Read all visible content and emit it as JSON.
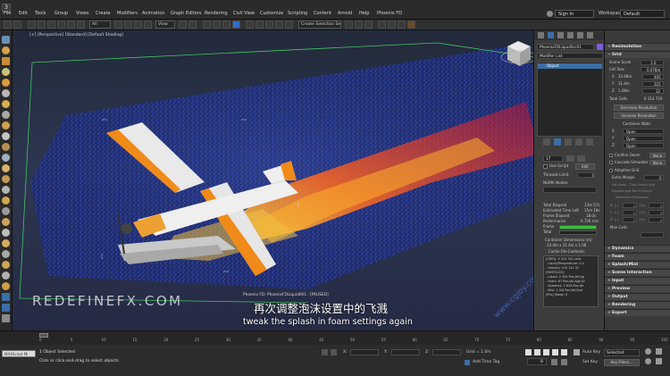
{
  "menubar": {
    "items": [
      "File",
      "Edit",
      "Tools",
      "Group",
      "Views",
      "Create",
      "Modifiers",
      "Animation",
      "Graph Editors",
      "Rendering",
      "Civil View",
      "Customize",
      "Scripting",
      "Content",
      "Arnold",
      "Help",
      "Phoenix FD"
    ],
    "signin": "Sign In",
    "workspaces_label": "Workspaces:",
    "workspaces_value": "Default"
  },
  "toolbar": {
    "selection_filter": "All",
    "view_dropdown": "View",
    "create_selection_set": "Create Selection Se"
  },
  "viewport": {
    "label": "[+] [Perspective] [Standard] [Default Shading]",
    "sim_label": "Phoenix FD: PhoenixFDLiquid001 : [PAUSED]",
    "watermark": "REDEFINEFX.COM",
    "subtitle_cn": "再次调整泡沫设置中的飞溅",
    "subtitle_en": "tweak the splash in foam settings again",
    "side_watermark": "www.cgjoy.com"
  },
  "command_panel": {
    "object_name": "PhoenixFDLiquidSrc01",
    "modifier_list": "Modifier List",
    "stack_item": "Object",
    "start_frame": "17",
    "use_script": "Use Script",
    "edit": "Edit",
    "threads_limit_label": "Threads Limit",
    "threads_limit": "0",
    "numa_nodes": "NUMA Nodes:",
    "numa_value": "",
    "stats": [
      [
        "Total Elapsed",
        "13m 57s"
      ],
      [
        "Estimated Time Left",
        "15m 18s"
      ],
      [
        "Frame Elapsed",
        "18.0s"
      ],
      [
        "Performance",
        "0.726 m/s"
      ],
      [
        "Frame",
        ""
      ],
      [
        "Total",
        ""
      ]
    ],
    "container_dimensions_label": "Container Dimensions (m):",
    "container_dimensions": "33.4m x 31.4m x 1.08",
    "cache_file_contents": "Cache File Contents:",
    "cache_lines": [
      "[GRID]: 6 314 720 cells",
      "- Liquid/Temperature: 0.4",
      "- Velocity: 0.0/ 141.31",
      "[PARTICLES]",
      "- Liquid: 2 354 Pos,Vel,Ag",
      "- Foam: 87 Pos,Vel,Age,Sz",
      "- Splashes: 2 634 Pos,Vel",
      "- Mist: 1 0/4 Pos,Vel,Size",
      "[Phx] Stage: 0"
    ]
  },
  "rollout": {
    "resimulation": "Resimulation",
    "grid": "Grid",
    "scene_scale_label": "Scene Scale",
    "scene_scale": "1.0",
    "cell_size_label": "Cell Size",
    "cell_size": "0.078m",
    "dims": [
      [
        "X",
        "33.68m",
        "405"
      ],
      [
        "Y",
        "31.4m",
        "325"
      ],
      [
        "Z",
        "1.08m",
        "32"
      ]
    ],
    "total_cells_label": "Total Cells",
    "total_cells": "6 314 720",
    "decrease_resolution": "Decrease Resolution",
    "increase_resolution": "Increase Resolution",
    "container_walls": "Container Walls",
    "walls": [
      [
        "X",
        "Open"
      ],
      [
        "Y",
        "Open"
      ],
      [
        "Z",
        "Open"
      ]
    ],
    "confine_geom_label": "Confine Geom",
    "confine_geom": "None",
    "cascade_label": "Cascade Simulator",
    "cascade": "None",
    "adaptive_grid": "Adaptive Grid",
    "extra_margin_label": "Extra Margin",
    "extra_margin": "0",
    "no_grow": "No Grow... Than Initial Grid",
    "expand": "Expand and Don't Shrink",
    "max_exp": "Maximum Expansion",
    "exp": [
      [
        "X",
        "(-)",
        "0",
        "(+)",
        "0"
      ],
      [
        "Y",
        "(-)",
        "0",
        "(+)",
        "0"
      ],
      [
        "Z",
        "(-)",
        "0",
        "(+)",
        "0"
      ]
    ],
    "max_cells_label": "Max Cells",
    "sections": [
      "Dynamics",
      "Foam",
      "Splash/Mist",
      "Scene Interaction",
      "Input",
      "Preview",
      "Output",
      "Rendering",
      "Export"
    ]
  },
  "timeline": {
    "ticks": [
      "0",
      "5",
      "10",
      "15",
      "20",
      "25",
      "30",
      "35",
      "40",
      "45",
      "50",
      "55",
      "60",
      "65",
      "70",
      "75",
      "80",
      "85",
      "90",
      "95",
      "100"
    ]
  },
  "status": {
    "line1": "1 Object Selected",
    "line2": "Click or click-and-drag to select objects",
    "maxscript": "MAXScript Mi",
    "x": "X:",
    "y": "Y:",
    "z": "Z:",
    "grid": "Grid = 1.0m",
    "add_time_tag": "Add Time Tag",
    "auto_key": "Auto Key",
    "selected": "Selected",
    "set_key": "Set Key",
    "key_filters": "Key Filters...",
    "frame": "8"
  },
  "colors": {
    "accent": "#ee8a1e",
    "panel": "#3a3a3a",
    "selection": "#3a6ea5",
    "frame_bar": "#36c23a"
  }
}
